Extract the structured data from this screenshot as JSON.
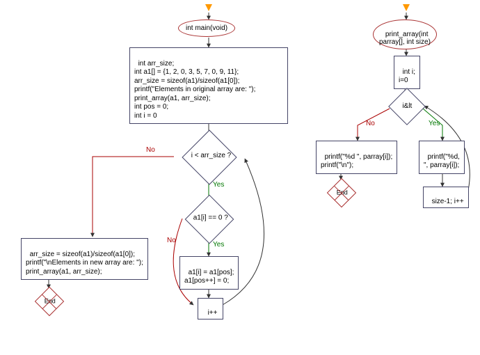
{
  "left": {
    "start": "int main(void)",
    "init": "int arr_size;\nint a1[] = {1, 2, 0, 3, 5, 7, 0, 9, 11};\narr_size = sizeof(a1)/sizeof(a1[0]);\nprintf(\"Elements in original array are: \");\nprint_array(a1, arr_size);\nint pos = 0;\nint i = 0",
    "cond1": "i < arr_size ?",
    "cond2": "a1[i] == 0 ?",
    "swap": "a1[i] = a1[pos];\na1[pos++] = 0;",
    "inc": "i++",
    "final": "arr_size = sizeof(a1)/sizeof(a1[0]);\nprintf(\"\\nElements in new array are: \");\nprint_array(a1, arr_size);",
    "end": "End"
  },
  "right": {
    "start": "print_array(int\nparray[], int size)",
    "init": "int i;\ni=0",
    "cond": "i&lt",
    "noBranch": "printf(\"%d \", parray[i]);\nprintf(\"\\n\");",
    "yesBranch": "printf(\"%d,\n\", parray[i]);",
    "inc": "size-1; i++",
    "end": "End"
  },
  "labels": {
    "yes": "Yes",
    "no": "No"
  }
}
